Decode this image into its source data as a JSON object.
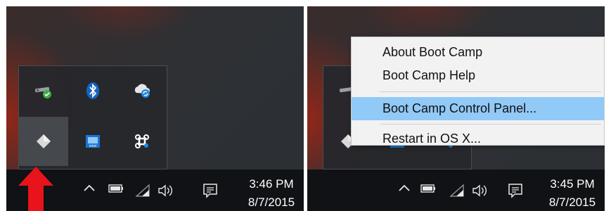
{
  "left_panel": {
    "tray_icons": [
      {
        "name": "network-icon"
      },
      {
        "name": "bluetooth-icon"
      },
      {
        "name": "cloud-sync-icon"
      },
      {
        "name": "boot-camp-icon"
      },
      {
        "name": "intel-graphics-icon"
      },
      {
        "name": "command-key-icon"
      }
    ],
    "clock": {
      "time": "3:46 PM",
      "date": "8/7/2015"
    }
  },
  "right_panel": {
    "context_menu": {
      "items": [
        {
          "label": "About Boot Camp"
        },
        {
          "label": "Boot Camp Help"
        },
        {
          "label": "Boot Camp Control Panel..."
        },
        {
          "label": "Restart in OS X..."
        }
      ],
      "selected_index": 2
    },
    "clock": {
      "time": "3:45 PM",
      "date": "8/7/2015"
    }
  },
  "system_icons": [
    "chevron-up-icon",
    "battery-icon",
    "wifi-icon",
    "volume-icon",
    "action-center-icon"
  ],
  "colors": {
    "highlight": "#91c9f7",
    "arrow": "#e8131b",
    "taskbar": "#101215"
  }
}
